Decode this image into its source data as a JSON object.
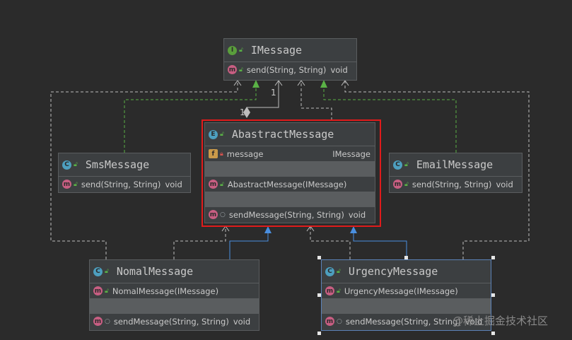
{
  "classes": {
    "imessage": {
      "name": "IMessage",
      "kind_badge": "I",
      "methods": [
        {
          "badge": "m",
          "signature": "send(String, String)",
          "return_type": "void"
        }
      ]
    },
    "abstract_message": {
      "name": "AbastractMessage",
      "kind_badge": "E",
      "fields": [
        {
          "badge": "f",
          "name": "message",
          "type": "IMessage"
        }
      ],
      "constructors": [
        {
          "badge": "m",
          "signature": "AbastractMessage(IMessage)"
        }
      ],
      "methods": [
        {
          "badge": "m",
          "signature": "sendMessage(String, String)",
          "return_type": "void"
        }
      ]
    },
    "sms_message": {
      "name": "SmsMessage",
      "kind_badge": "C",
      "methods": [
        {
          "badge": "m",
          "signature": "send(String, String)",
          "return_type": "void"
        }
      ]
    },
    "email_message": {
      "name": "EmailMessage",
      "kind_badge": "C",
      "methods": [
        {
          "badge": "m",
          "signature": "send(String, String)",
          "return_type": "void"
        }
      ]
    },
    "nomal_message": {
      "name": "NomalMessage",
      "kind_badge": "C",
      "constructors": [
        {
          "badge": "m",
          "signature": "NomalMessage(IMessage)"
        }
      ],
      "methods": [
        {
          "badge": "m",
          "signature": "sendMessage(String, String)",
          "return_type": "void"
        }
      ]
    },
    "urgency_message": {
      "name": "UrgencyMessage",
      "kind_badge": "C",
      "constructors": [
        {
          "badge": "m",
          "signature": "UrgencyMessage(IMessage)"
        }
      ],
      "methods": [
        {
          "badge": "m",
          "signature": "sendMessage(String, String)",
          "return_type": "void"
        }
      ]
    }
  },
  "multiplicities": {
    "target": "1",
    "source": "1"
  },
  "watermark": "@稀土掘金技术社区",
  "colors": {
    "background": "#2b2b2b",
    "box": "#3c3f41",
    "border": "#5a5d5f",
    "implements_arrow": "#5ab146",
    "extends_arrow": "#4a8fe0",
    "highlight": "#e01b1b"
  }
}
